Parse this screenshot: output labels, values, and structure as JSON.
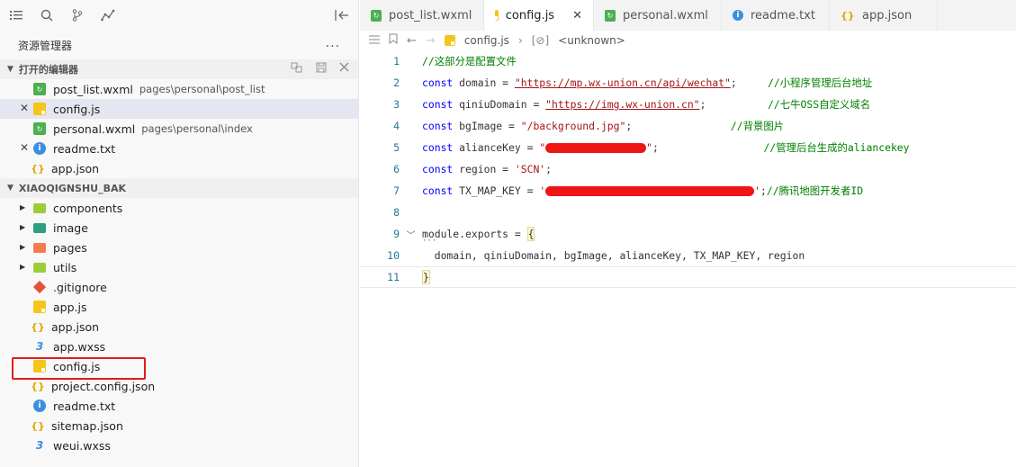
{
  "sidebar": {
    "explorer_title": "资源管理器",
    "more": "...",
    "open_editors": {
      "title": "打开的编辑器",
      "items": [
        {
          "name": "post_list.wxml",
          "path": "pages\\personal\\post_list",
          "icon": "wxml"
        },
        {
          "name": "config.js",
          "path": "",
          "icon": "js"
        },
        {
          "name": "personal.wxml",
          "path": "pages\\personal\\index",
          "icon": "wxml"
        },
        {
          "name": "readme.txt",
          "path": "",
          "icon": "info"
        },
        {
          "name": "app.json",
          "path": "",
          "icon": "json"
        }
      ]
    },
    "project": {
      "title": "XIAOQIGNSHU_BAK",
      "items": [
        {
          "name": "components",
          "icon": "folder-components"
        },
        {
          "name": "image",
          "icon": "folder-image"
        },
        {
          "name": "pages",
          "icon": "folder-pages"
        },
        {
          "name": "utils",
          "icon": "folder-utils"
        },
        {
          "name": ".gitignore",
          "icon": "git"
        },
        {
          "name": "app.js",
          "icon": "js"
        },
        {
          "name": "app.json",
          "icon": "json"
        },
        {
          "name": "app.wxss",
          "icon": "wxss"
        },
        {
          "name": "config.js",
          "icon": "js"
        },
        {
          "name": "project.config.json",
          "icon": "json"
        },
        {
          "name": "readme.txt",
          "icon": "info"
        },
        {
          "name": "sitemap.json",
          "icon": "json"
        },
        {
          "name": "weui.wxss",
          "icon": "wxss"
        }
      ]
    }
  },
  "tabs": [
    {
      "label": "post_list.wxml",
      "icon": "wxml"
    },
    {
      "label": "config.js",
      "icon": "js"
    },
    {
      "label": "personal.wxml",
      "icon": "wxml"
    },
    {
      "label": "readme.txt",
      "icon": "info"
    },
    {
      "label": "app.json",
      "icon": "json"
    }
  ],
  "breadcrumb": {
    "file": "config.js",
    "symbol": "<unknown>"
  },
  "code": {
    "line_numbers": [
      "1",
      "2",
      "3",
      "4",
      "5",
      "6",
      "7",
      "8",
      "9",
      "10",
      "11"
    ],
    "l1_comment": "//这部分是配置文件",
    "l2_kw": "const",
    "l2_rest": " domain = ",
    "l2_str": "\"https://mp.wx-union.cn/api/wechat\"",
    "l2_semi": ";     ",
    "l2_comment": "//小程序管理后台地址",
    "l3_kw": "const",
    "l3_rest": " qiniuDomain = ",
    "l3_str": "\"https://img.wx-union.cn\"",
    "l3_semi": ";          ",
    "l3_comment": "//七牛OSS自定义域名",
    "l4_kw": "const",
    "l4_rest": " bgImage = ",
    "l4_str": "\"/background.jpg\"",
    "l4_semi": ";                ",
    "l4_comment": "//背景图片",
    "l5_kw": "const",
    "l5_rest": " alianceKey = ",
    "l5_q1": "\"",
    "l5_q2": "\"",
    "l5_semi": ";                 ",
    "l5_comment": "//管理后台生成的aliancekey",
    "l6_kw": "const",
    "l6_rest": " region = ",
    "l6_str": "'SCN'",
    "l6_semi": ";",
    "l7_kw": "const",
    "l7_rest": " TX_MAP_KEY = ",
    "l7_q1": "'",
    "l7_q2": "'",
    "l7_semi": ";",
    "l7_comment": "//腾讯地图开发者ID",
    "l9_text": "module.exports = ",
    "l9_brace": "{",
    "l10_text": "  domain, qiniuDomain, bgImage, alianceKey, TX_MAP_KEY, region",
    "l11_brace": "}"
  },
  "colors": {
    "highlight_box": "#e11d1d",
    "redaction": "#f01515",
    "selected_row": "#e4e6f1"
  }
}
